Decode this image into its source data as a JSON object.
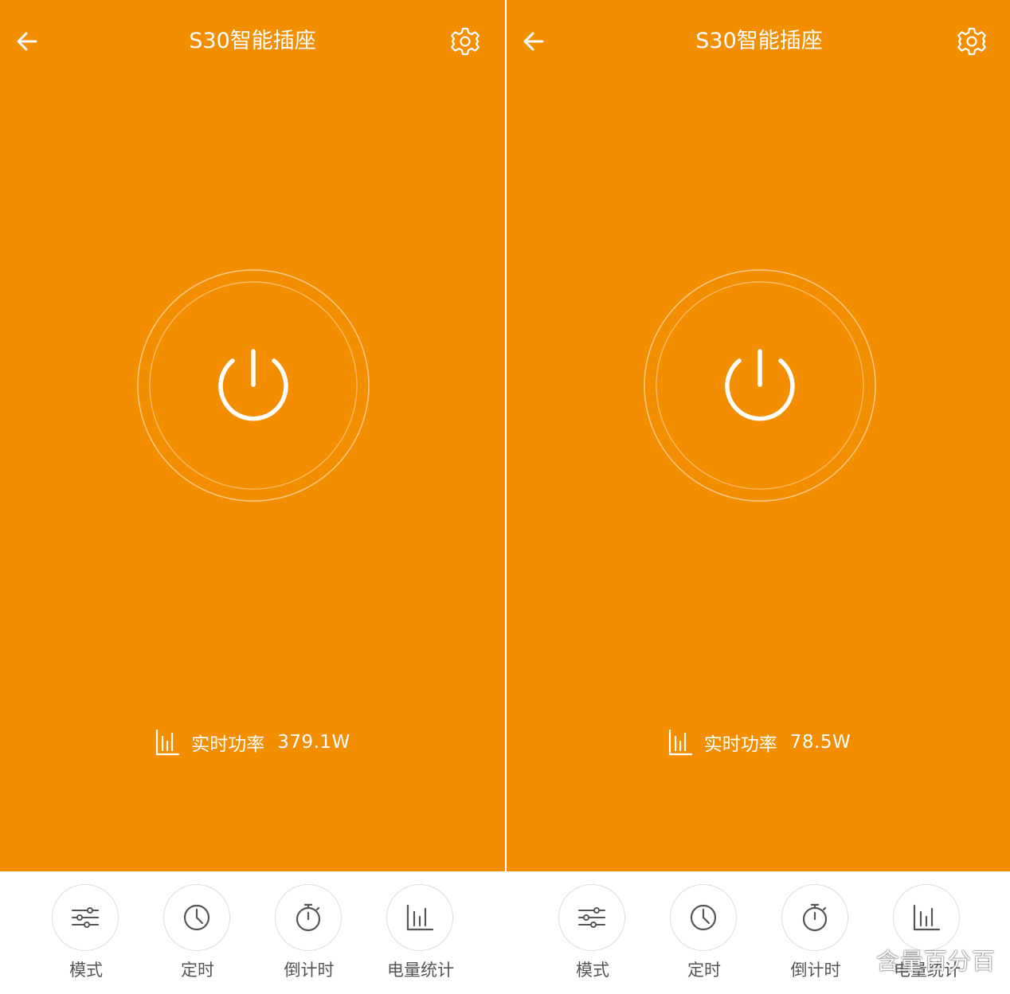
{
  "colors": {
    "accent": "#F38E00",
    "dock_bg": "#FFFFFF",
    "icon_gray": "#555555",
    "ring": "#FFFFFF"
  },
  "screens": [
    {
      "header": {
        "title": "S30智能插座",
        "back_icon": "arrow-left-icon",
        "settings_icon": "gear-icon"
      },
      "power_button": {
        "icon": "power-icon",
        "state": "on"
      },
      "power_reading": {
        "label": "实时功率",
        "value": "379.1W",
        "icon": "bar-chart-icon"
      },
      "dock": [
        {
          "label": "模式",
          "icon": "sliders-icon"
        },
        {
          "label": "定时",
          "icon": "clock-icon"
        },
        {
          "label": "倒计时",
          "icon": "stopwatch-icon"
        },
        {
          "label": "电量统计",
          "icon": "bar-chart-icon"
        }
      ]
    },
    {
      "header": {
        "title": "S30智能插座",
        "back_icon": "arrow-left-icon",
        "settings_icon": "gear-icon"
      },
      "power_button": {
        "icon": "power-icon",
        "state": "on"
      },
      "power_reading": {
        "label": "实时功率",
        "value": "78.5W",
        "icon": "bar-chart-icon"
      },
      "dock": [
        {
          "label": "模式",
          "icon": "sliders-icon"
        },
        {
          "label": "定时",
          "icon": "clock-icon"
        },
        {
          "label": "倒计时",
          "icon": "stopwatch-icon"
        },
        {
          "label": "电量统计",
          "icon": "bar-chart-icon"
        }
      ]
    }
  ],
  "watermark": "含量百分百"
}
